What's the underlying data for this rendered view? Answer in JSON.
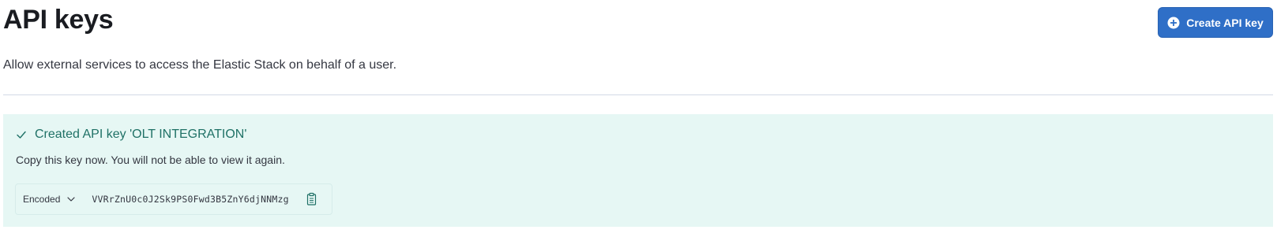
{
  "header": {
    "title": "API keys",
    "create_button_label": "Create API key",
    "description": "Allow external services to access the Elastic Stack on behalf of a user."
  },
  "callout": {
    "title": "Created API key 'OLT INTEGRATION'",
    "body": "Copy this key now. You will not be able to view it again.",
    "format_selected": "Encoded",
    "key_value": "VVRrZnU0c0J2Sk9PS0Fwd3B5ZnY6djNNMzg",
    "status_color": "#1f7166",
    "background_color": "#e6f7f4"
  },
  "icons": {
    "create": "plus-in-circle-icon",
    "success": "check-icon",
    "format_dropdown": "chevron-down-icon",
    "copy": "copy-clipboard-icon"
  },
  "colors": {
    "primary": "#2f6fc7",
    "text": "#343741",
    "heading": "#1a1c21"
  }
}
